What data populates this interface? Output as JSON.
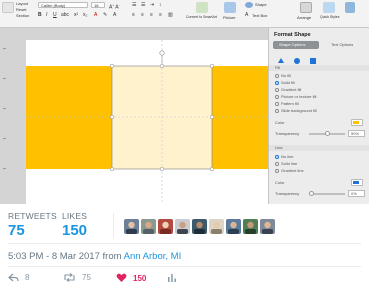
{
  "ppt": {
    "font_name": "Calibri (Body)",
    "font_size": "18",
    "paste_label": "Paste",
    "clipboard_items": [
      "Layout",
      "Reset",
      "Section"
    ],
    "convert_label": "Convert to SmartArt",
    "picture_label": "Picture",
    "textbox_label": "Text Box",
    "arrange_label": "Arrange",
    "quick_styles_label": "Quick Styles",
    "shape_label": "Shape",
    "colors": {
      "gold": "#ffc000",
      "light_gold": "#fff2cc",
      "accent_blue": "#1e74d6"
    }
  },
  "pane": {
    "title": "Format Shape",
    "tab_shape": "Shape Options",
    "tab_text": "Text Options",
    "fill_header": "Fill",
    "fill_options": [
      "No fill",
      "Solid fill",
      "Gradient fill",
      "Picture or texture fill",
      "Pattern fill",
      "Slide background fill"
    ],
    "color_label": "Color",
    "transparency_label": "Transparency",
    "fill_transparency": "50%",
    "line_header": "Line",
    "line_options": [
      "No line",
      "Solid line",
      "Gradient line"
    ],
    "line_color_label": "Color",
    "line_transparency_label": "Transparency",
    "line_transparency": "0%"
  },
  "tweet": {
    "retweets_label": "RETWEETS",
    "retweets_count": "75",
    "likes_label": "LIKES",
    "likes_count": "150",
    "avatar_count": 9,
    "timestamp": "5:03 PM - 8 Mar 2017 from",
    "location": "Ann Arbor, MI",
    "actions": {
      "reply_count": "8",
      "retweet_count": "75",
      "like_count": "150"
    },
    "colors": {
      "link": "#1b95e0",
      "like": "#e0245e",
      "muted": "#8899a6"
    }
  }
}
